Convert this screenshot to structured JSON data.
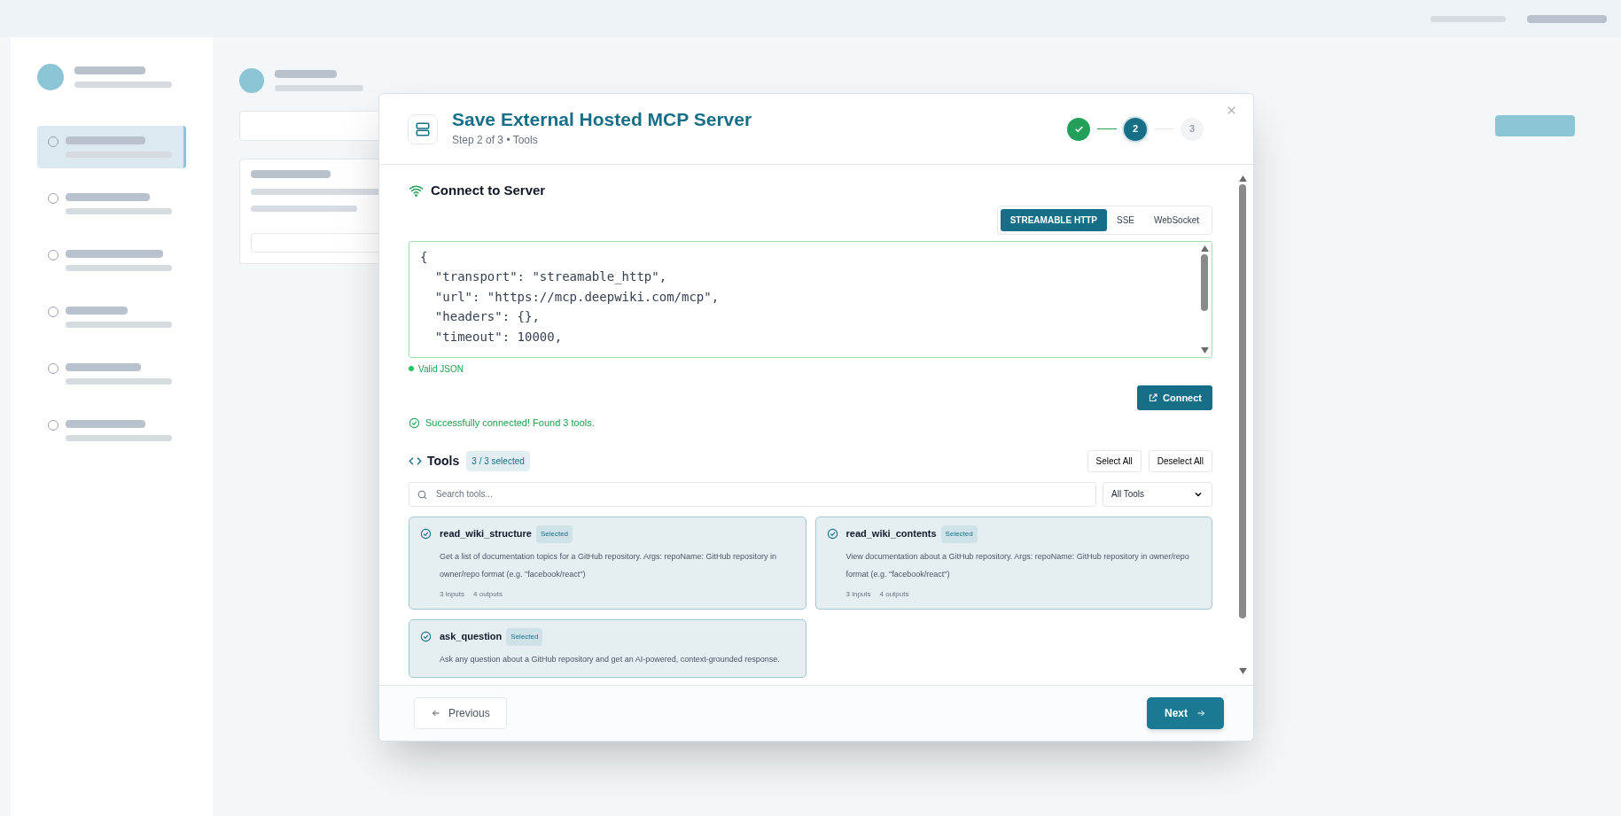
{
  "sidebar": {
    "items": [
      {
        "selected": true
      },
      {
        "selected": false
      },
      {
        "selected": false
      },
      {
        "selected": false
      },
      {
        "selected": false
      },
      {
        "selected": false
      }
    ]
  },
  "modal": {
    "title": "Save External Hosted MCP Server",
    "subtitle": "Step 2 of 3 • Tools",
    "steps": [
      {
        "completed": true,
        "selected": false
      },
      {
        "label": "2",
        "completed": false,
        "selected": true
      },
      {
        "label": "3",
        "completed": false,
        "selected": false
      }
    ],
    "section_title": "Connect to Server",
    "transports": [
      {
        "label": "STREAMABLE HTTP",
        "selected": true
      },
      {
        "label": "SSE",
        "selected": false
      },
      {
        "label": "WebSocket",
        "selected": false
      }
    ],
    "config_lines": [
      "{",
      "  \"transport\": \"streamable_http\",",
      "  \"url\": \"https://mcp.deepwiki.com/mcp\",",
      "  \"headers\": {},",
      "  \"timeout\": 10000,"
    ],
    "validity": {
      "text": "Valid JSON",
      "valid": true
    },
    "connect_button": "Connect",
    "success_message": "Successfully connected! Found 3 tools.",
    "tools": {
      "title": "Tools",
      "count": "3 / 3 selected",
      "select_all": "Select All",
      "deselect_all": "Deselect All",
      "search": {
        "placeholder": "Search tools..."
      },
      "filter": "All Tools",
      "items": [
        {
          "name": "read_wiki_structure",
          "badge": "Selected",
          "selected": true,
          "description": "Get a list of documentation topics for a GitHub repository. Args: repoName: GitHub repository in owner/repo format (e.g. \"facebook/react\")",
          "inputs": "3 inputs",
          "outputs": "4 outputs"
        },
        {
          "name": "read_wiki_contents",
          "badge": "Selected",
          "selected": true,
          "description": "View documentation about a GitHub repository. Args: repoName: GitHub repository in owner/repo format (e.g. \"facebook/react\")",
          "inputs": "3 inputs",
          "outputs": "4 outputs"
        },
        {
          "name": "ask_question",
          "badge": "Selected",
          "selected": true,
          "description": "Ask any question about a GitHub repository and get an AI-powered, context-grounded response."
        }
      ]
    },
    "footer": {
      "previous": "Previous",
      "next": "Next"
    }
  }
}
